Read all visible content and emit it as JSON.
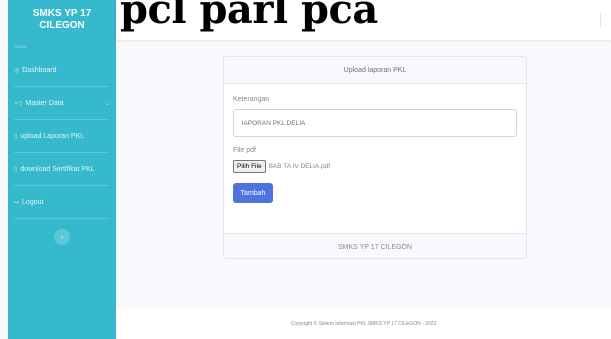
{
  "overlay": {
    "text": "pcl parl pca"
  },
  "sidebar": {
    "brand_line1": "SMKS YP 17",
    "brand_line2": "CILEGON",
    "heading": "SISWA",
    "items": [
      {
        "icon": "◎",
        "label": "Dashboard"
      },
      {
        "icon": "> ▯",
        "label": "Master Data",
        "chevron": "⌄"
      },
      {
        "icon": "▯",
        "label": "upload Laporan PKL"
      },
      {
        "icon": "▯",
        "label": "download Sertifikat PKL"
      },
      {
        "icon": "↦",
        "label": "Logout"
      }
    ],
    "toggle": "‹"
  },
  "card": {
    "header": "Upload laporan PKL",
    "keterangan_label": "Keterangan",
    "keterangan_value": "lAPORAN PKL DELIA",
    "file_label": "File pdf",
    "file_button": "Pilih File",
    "file_name": "BAB TA IV DELIA.pdf",
    "submit_label": "Tambah",
    "footer": "SMKS YP 17 CILEGON"
  },
  "footer": {
    "copyright": "Copyright © Sistem Informasi PKL SMKS YP 17 CILEGON - 2023"
  },
  "colors": {
    "sidebar": "#36b9cc",
    "primary": "#4e73df"
  }
}
